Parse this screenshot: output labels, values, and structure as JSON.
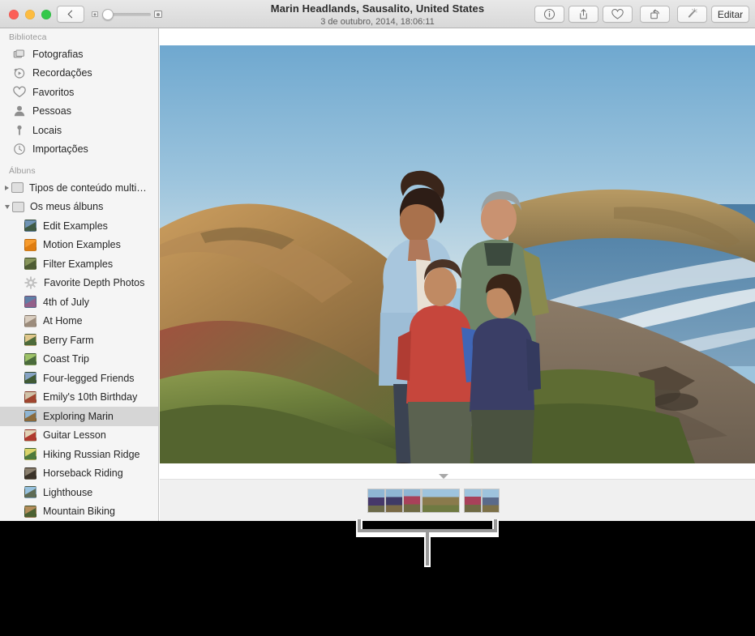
{
  "window": {
    "title": "Marin Headlands, Sausalito, United States",
    "subtitle": "3 de outubro, 2014, 18:06:11"
  },
  "traffic_lights": {
    "close": "close-button",
    "minimize": "minimize-button",
    "maximize": "maximize-button",
    "close_color": "#fc5f57",
    "minimize_color": "#fdbc40",
    "maximize_color": "#34c84a"
  },
  "toolbar": {
    "back_label": "",
    "back_icon": "chevron-left-icon",
    "zoom_slider": {
      "left_icon": "small-thumbnail-icon",
      "right_icon": "large-thumbnail-icon",
      "value": 24
    },
    "buttons": [
      {
        "name": "info-button",
        "icon": "info-circle-icon",
        "label": ""
      },
      {
        "name": "share-button",
        "icon": "share-arrow-icon",
        "label": ""
      },
      {
        "name": "favorite-button",
        "icon": "heart-icon",
        "label": ""
      },
      {
        "name": "rotate-button",
        "icon": "rotate-left-icon",
        "label": ""
      },
      {
        "name": "enhance-button",
        "icon": "magic-wand-icon",
        "label": ""
      }
    ],
    "edit_label": "Editar"
  },
  "sidebar": {
    "sections": [
      {
        "heading": "Biblioteca",
        "items": [
          {
            "label": "Fotografias",
            "icon": "photos-icon"
          },
          {
            "label": "Recordações",
            "icon": "memories-clock-icon"
          },
          {
            "label": "Favoritos",
            "icon": "heart-icon"
          },
          {
            "label": "Pessoas",
            "icon": "person-icon"
          },
          {
            "label": "Locais",
            "icon": "map-pin-icon"
          },
          {
            "label": "Importações",
            "icon": "clock-icon"
          }
        ]
      },
      {
        "heading": "Álbuns",
        "groups": [
          {
            "label": "Tipos de conteúdo multi…",
            "icon": "folder-icon",
            "expanded": false
          },
          {
            "label": "Os meus álbuns",
            "icon": "folder-icon",
            "expanded": true
          }
        ],
        "albums": [
          {
            "label": "Edit Examples",
            "icon": "album-thumbnail",
            "selected": false,
            "c1": "#6f93b4",
            "c2": "#3f5a44"
          },
          {
            "label": "Motion Examples",
            "icon": "album-thumbnail",
            "selected": false,
            "c1": "#f79b2d",
            "c2": "#e07d10"
          },
          {
            "label": "Filter Examples",
            "icon": "album-thumbnail",
            "selected": false,
            "c1": "#86945a",
            "c2": "#4e5c34"
          },
          {
            "label": "Favorite Depth Photos",
            "icon": "gear-icon",
            "selected": false,
            "c1": "#cccccc",
            "c2": "#b3b3b3"
          },
          {
            "label": "4th of July",
            "icon": "album-thumbnail",
            "selected": false,
            "c1": "#5f7fa6",
            "c2": "#93608a"
          },
          {
            "label": "At Home",
            "icon": "album-thumbnail",
            "selected": false,
            "c1": "#d9cdbf",
            "c2": "#9c8c7c"
          },
          {
            "label": "Berry Farm",
            "icon": "album-thumbnail",
            "selected": false,
            "c1": "#e0c78b",
            "c2": "#4d6b3a"
          },
          {
            "label": "Coast Trip",
            "icon": "album-thumbnail",
            "selected": false,
            "c1": "#9ec268",
            "c2": "#4a6b3c"
          },
          {
            "label": "Four-legged Friends",
            "icon": "album-thumbnail",
            "selected": false,
            "c1": "#86a3c4",
            "c2": "#3f5a34"
          },
          {
            "label": "Emily's 10th Birthday",
            "icon": "album-thumbnail",
            "selected": false,
            "c1": "#d0c2a8",
            "c2": "#a1452f"
          },
          {
            "label": "Exploring Marin",
            "icon": "album-thumbnail",
            "selected": true,
            "c1": "#8fb6d4",
            "c2": "#8a6a3c"
          },
          {
            "label": "Guitar Lesson",
            "icon": "album-thumbnail",
            "selected": false,
            "c1": "#e2d3b6",
            "c2": "#b03a2e"
          },
          {
            "label": "Hiking Russian Ridge",
            "icon": "album-thumbnail",
            "selected": false,
            "c1": "#d9d46a",
            "c2": "#4e7a3c"
          },
          {
            "label": "Horseback Riding",
            "icon": "album-thumbnail",
            "selected": false,
            "c1": "#8a7f6e",
            "c2": "#3a3228"
          },
          {
            "label": "Lighthouse",
            "icon": "album-thumbnail",
            "selected": false,
            "c1": "#96c1de",
            "c2": "#5e6b54"
          },
          {
            "label": "Mountain Biking",
            "icon": "album-thumbnail",
            "selected": false,
            "c1": "#b38d5a",
            "c2": "#4c6232"
          }
        ]
      }
    ]
  },
  "photo": {
    "alt": "Family of four posing on a coastal hillside at Marin Headlands with ocean and beach behind",
    "sky_top": "#7fb1d4",
    "sky_bottom": "#bcd8e6",
    "ocean": "#5f89ab",
    "sand": "#9a8873",
    "hill_near": "#7d6a3c",
    "foliage": "#6d7a3b"
  },
  "thumbnail_strip": {
    "arrow_icon": "triangle-down-icon",
    "groups": [
      {
        "name": "thumb-group-left",
        "count": 4
      },
      {
        "name": "thumb-group-center",
        "count": 1
      },
      {
        "name": "thumb-group-right",
        "count": 2
      }
    ]
  },
  "callout": {
    "name": "callout-bracket",
    "description": "",
    "color": "#9a9a9a"
  }
}
